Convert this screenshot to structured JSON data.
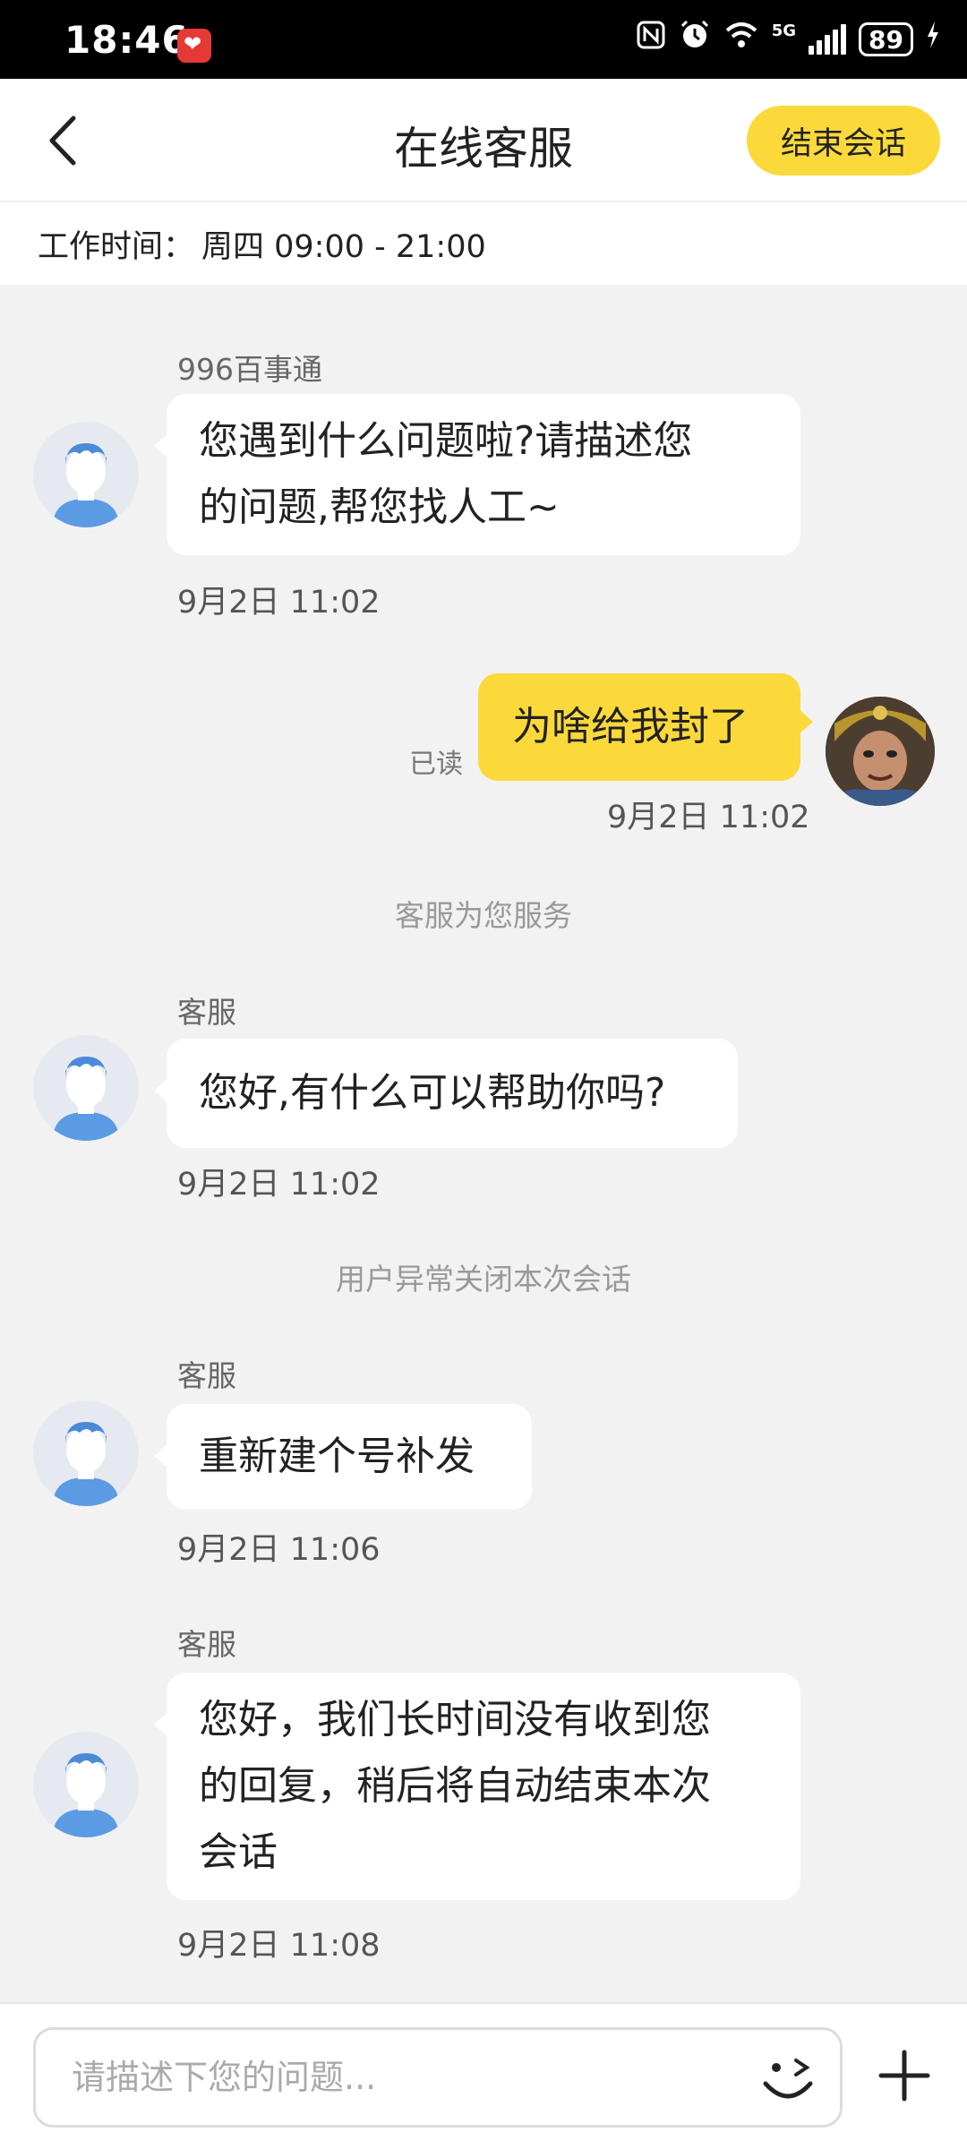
{
  "status_bar": {
    "time": "18:46",
    "network": "5G",
    "battery": "89"
  },
  "header": {
    "title": "在线客服",
    "end_button": "结束会话"
  },
  "work_hours": {
    "label": "工作时间：",
    "value": "周四 09:00 - 21:00"
  },
  "messages": [
    {
      "sender": "996百事通",
      "lines": [
        "您遇到什么问题啦?请描述您",
        "的问题,帮您找人工~"
      ],
      "time": "9月2日 11:02"
    },
    {
      "text": "为啥给我封了",
      "status": "已读",
      "time": "9月2日 11:02"
    },
    {
      "text": "客服为您服务"
    },
    {
      "sender": "客服",
      "lines": [
        "您好,有什么可以帮助你吗?"
      ],
      "time": "9月2日 11:02"
    },
    {
      "text": "用户异常关闭本次会话"
    },
    {
      "sender": "客服",
      "lines": [
        "重新建个号补发"
      ],
      "time": "9月2日 11:06"
    },
    {
      "sender": "客服",
      "lines": [
        "您好，我们长时间没有收到您",
        "的回复，稍后将自动结束本次",
        "会话"
      ],
      "time": "9月2日 11:08"
    }
  ],
  "input": {
    "placeholder": "请描述下您的问题..."
  },
  "colors": {
    "accent": "#fbd93b",
    "background": "#f2f2f2"
  },
  "icons": [
    "back-arrow-icon",
    "nfc-icon",
    "alarm-icon",
    "wifi-icon",
    "signal-icon",
    "battery-icon",
    "emoji-icon",
    "plus-icon"
  ]
}
